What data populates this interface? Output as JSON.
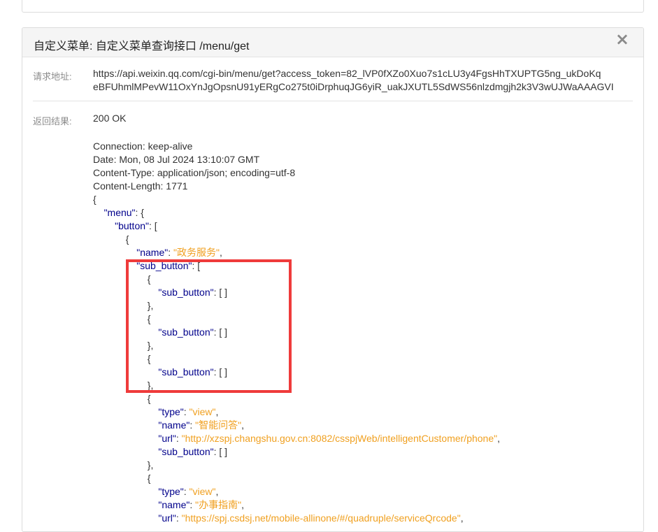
{
  "panel": {
    "title": "自定义菜单: 自定义菜单查询接口 /menu/get",
    "close_icon": "×"
  },
  "request": {
    "label": "请求地址:",
    "url_line1": "https://api.weixin.qq.com/cgi-bin/menu/get?access_token=82_lVP0fXZo0Xuo7s1cLU3y4FgsHhTXUPTG5ng_ukDoKq",
    "url_line2": "eBFUhmlMPevW11OxYnJgOpsnU91yERgCo275t0iDrphuqJG6yiR_uakJXUTL5SdWS56nlzdmgjh2k3V3wUJWaAAAGVI"
  },
  "response": {
    "label": "返回结果:",
    "status": "200 OK",
    "headers": [
      "Connection: keep-alive",
      "Date: Mon, 08 Jul 2024 13:10:07 GMT",
      "Content-Type: application/json; encoding=utf-8",
      "Content-Length: 1771"
    ],
    "json_lines": [
      {
        "indent": "",
        "parts": [
          {
            "t": "p",
            "v": "{"
          }
        ]
      },
      {
        "indent": "    ",
        "parts": [
          {
            "t": "k",
            "v": "\"menu\""
          },
          {
            "t": "p",
            "v": ": {"
          }
        ]
      },
      {
        "indent": "        ",
        "parts": [
          {
            "t": "k",
            "v": "\"button\""
          },
          {
            "t": "p",
            "v": ": ["
          }
        ]
      },
      {
        "indent": "            ",
        "parts": [
          {
            "t": "p",
            "v": "{"
          }
        ]
      },
      {
        "indent": "                ",
        "parts": [
          {
            "t": "k",
            "v": "\"name\""
          },
          {
            "t": "p",
            "v": ": "
          },
          {
            "t": "s",
            "v": "\"政务服务\""
          },
          {
            "t": "p",
            "v": ","
          }
        ]
      },
      {
        "indent": "                ",
        "parts": [
          {
            "t": "k",
            "v": "\"sub_button\""
          },
          {
            "t": "p",
            "v": ": ["
          }
        ]
      },
      {
        "indent": "                    ",
        "parts": [
          {
            "t": "p",
            "v": "{"
          }
        ]
      },
      {
        "indent": "                        ",
        "parts": [
          {
            "t": "k",
            "v": "\"sub_button\""
          },
          {
            "t": "p",
            "v": ": [ ]"
          }
        ]
      },
      {
        "indent": "                    ",
        "parts": [
          {
            "t": "p",
            "v": "},"
          }
        ]
      },
      {
        "indent": "                    ",
        "parts": [
          {
            "t": "p",
            "v": "{"
          }
        ]
      },
      {
        "indent": "                        ",
        "parts": [
          {
            "t": "k",
            "v": "\"sub_button\""
          },
          {
            "t": "p",
            "v": ": [ ]"
          }
        ]
      },
      {
        "indent": "                    ",
        "parts": [
          {
            "t": "p",
            "v": "},"
          }
        ]
      },
      {
        "indent": "                    ",
        "parts": [
          {
            "t": "p",
            "v": "{"
          }
        ]
      },
      {
        "indent": "                        ",
        "parts": [
          {
            "t": "k",
            "v": "\"sub_button\""
          },
          {
            "t": "p",
            "v": ": [ ]"
          }
        ]
      },
      {
        "indent": "                    ",
        "parts": [
          {
            "t": "p",
            "v": "},"
          }
        ]
      },
      {
        "indent": "                    ",
        "parts": [
          {
            "t": "p",
            "v": "{"
          }
        ]
      },
      {
        "indent": "                        ",
        "parts": [
          {
            "t": "k",
            "v": "\"type\""
          },
          {
            "t": "p",
            "v": ": "
          },
          {
            "t": "s",
            "v": "\"view\""
          },
          {
            "t": "p",
            "v": ","
          }
        ]
      },
      {
        "indent": "                        ",
        "parts": [
          {
            "t": "k",
            "v": "\"name\""
          },
          {
            "t": "p",
            "v": ": "
          },
          {
            "t": "s",
            "v": "\"智能问答\""
          },
          {
            "t": "p",
            "v": ","
          }
        ]
      },
      {
        "indent": "                        ",
        "parts": [
          {
            "t": "k",
            "v": "\"url\""
          },
          {
            "t": "p",
            "v": ": "
          },
          {
            "t": "s",
            "v": "\"http://xzspj.changshu.gov.cn:8082/csspjWeb/intelligentCustomer/phone\""
          },
          {
            "t": "p",
            "v": ","
          }
        ]
      },
      {
        "indent": "                        ",
        "parts": [
          {
            "t": "k",
            "v": "\"sub_button\""
          },
          {
            "t": "p",
            "v": ": [ ]"
          }
        ]
      },
      {
        "indent": "                    ",
        "parts": [
          {
            "t": "p",
            "v": "},"
          }
        ]
      },
      {
        "indent": "                    ",
        "parts": [
          {
            "t": "p",
            "v": "{"
          }
        ]
      },
      {
        "indent": "                        ",
        "parts": [
          {
            "t": "k",
            "v": "\"type\""
          },
          {
            "t": "p",
            "v": ": "
          },
          {
            "t": "s",
            "v": "\"view\""
          },
          {
            "t": "p",
            "v": ","
          }
        ]
      },
      {
        "indent": "                        ",
        "parts": [
          {
            "t": "k",
            "v": "\"name\""
          },
          {
            "t": "p",
            "v": ": "
          },
          {
            "t": "s",
            "v": "\"办事指南\""
          },
          {
            "t": "p",
            "v": ","
          }
        ]
      },
      {
        "indent": "                        ",
        "parts": [
          {
            "t": "k",
            "v": "\"url\""
          },
          {
            "t": "p",
            "v": ": "
          },
          {
            "t": "s",
            "v": "\"https://spj.csdsj.net/mobile-allinone/#/quadruple/serviceQrcode\""
          },
          {
            "t": "p",
            "v": ","
          }
        ]
      }
    ]
  },
  "colors": {
    "json_key": "#00008b",
    "json_string": "#f0a020",
    "highlight_border": "#ef3b3b",
    "header_bg": "#f5f5f5"
  }
}
